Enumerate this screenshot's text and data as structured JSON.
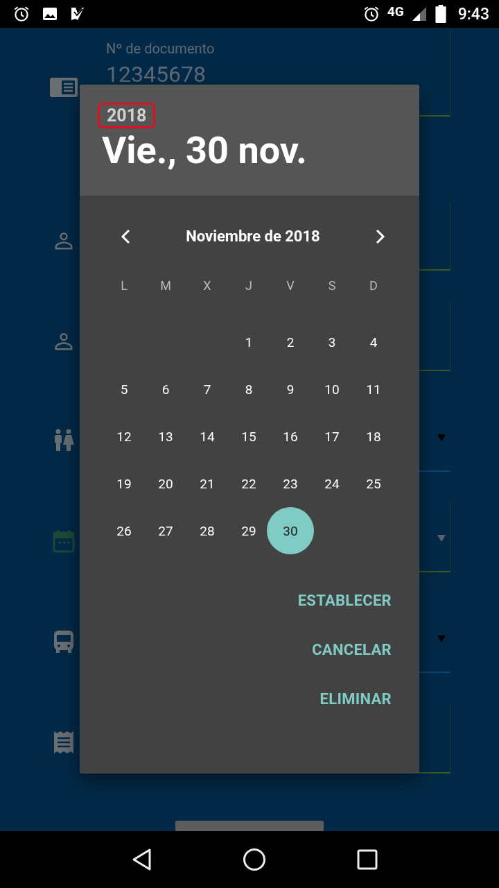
{
  "status_bar": {
    "network": "4G",
    "time": "9:43"
  },
  "form": {
    "fields": [
      {
        "kind": "text",
        "label": "Nº de documento",
        "value": "12345678"
      },
      {
        "kind": "text"
      },
      {
        "kind": "text"
      },
      {
        "kind": "select"
      },
      {
        "kind": "date"
      },
      {
        "kind": "select"
      },
      {
        "kind": "text"
      }
    ]
  },
  "dialog": {
    "year": {
      "text": "2018",
      "highlighted": true
    },
    "date": "Vie., 30 nov.",
    "month": "Noviembre de 2018",
    "weekdays": [
      "L",
      "M",
      "X",
      "J",
      "V",
      "S",
      "D"
    ],
    "weeks": [
      {
        "days": [
          {
            "text": "1",
            "selected": false
          },
          {
            "text": "2",
            "selected": false
          },
          {
            "text": "3",
            "selected": false
          },
          {
            "text": "4",
            "selected": false
          }
        ]
      },
      {
        "days": [
          {
            "text": "5",
            "selected": false
          },
          {
            "text": "6",
            "selected": false
          },
          {
            "text": "7",
            "selected": false
          },
          {
            "text": "8",
            "selected": false
          },
          {
            "text": "9",
            "selected": false
          },
          {
            "text": "10",
            "selected": false
          },
          {
            "text": "11",
            "selected": false
          }
        ]
      },
      {
        "days": [
          {
            "text": "12",
            "selected": false
          },
          {
            "text": "13",
            "selected": false
          },
          {
            "text": "14",
            "selected": false
          },
          {
            "text": "15",
            "selected": false
          },
          {
            "text": "16",
            "selected": false
          },
          {
            "text": "17",
            "selected": false
          },
          {
            "text": "18",
            "selected": false
          }
        ]
      },
      {
        "days": [
          {
            "text": "19",
            "selected": false
          },
          {
            "text": "20",
            "selected": false
          },
          {
            "text": "21",
            "selected": false
          },
          {
            "text": "22",
            "selected": false
          },
          {
            "text": "23",
            "selected": false
          },
          {
            "text": "24",
            "selected": false
          },
          {
            "text": "25",
            "selected": false
          }
        ]
      },
      {
        "days": [
          {
            "text": "26",
            "selected": false
          },
          {
            "text": "27",
            "selected": false
          },
          {
            "text": "28",
            "selected": false
          },
          {
            "text": "29",
            "selected": false
          },
          {
            "text": "30",
            "selected": true
          }
        ]
      }
    ],
    "buttons": [
      "ESTABLECER",
      "CANCELAR",
      "ELIMINAR"
    ]
  }
}
